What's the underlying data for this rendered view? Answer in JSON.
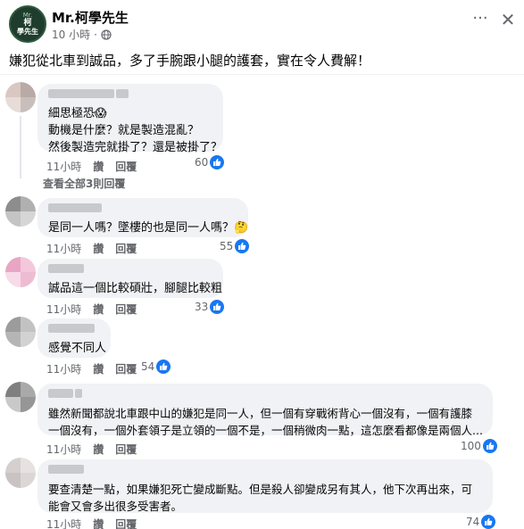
{
  "header": {
    "page_name": "Mr.柯學先生",
    "time": "10 小時",
    "avatar_small": "Mr.",
    "avatar_line1": "柯",
    "avatar_line2": "學先生",
    "more_icon": "more-horizontal-icon",
    "close_icon": "close-icon"
  },
  "post": {
    "text": "嫌犯從北車到誠品，多了手腕跟小腿的護套，實在令人費解！"
  },
  "labels": {
    "like": "讚",
    "reply": "回覆"
  },
  "comments": [
    {
      "lines": [
        "細思極恐😱",
        "動機是什麼？就是製造混亂？",
        "然後製造完就掛了？還是被掛了？"
      ],
      "time": "11小時",
      "reactions": "60",
      "view_replies": "查看全部3則回覆"
    },
    {
      "lines": [
        "是同一人嗎？墜樓的也是同一人嗎？🤔"
      ],
      "time": "11小時",
      "reactions": "55"
    },
    {
      "lines": [
        "誠品這一個比較碩壯，腳腿比較粗"
      ],
      "time": "11小時",
      "reactions": "33"
    },
    {
      "lines": [
        "感覺不同人"
      ],
      "time": "11小時",
      "reactions": "54"
    },
    {
      "lines": [
        "雖然新聞都說北車跟中山的嫌犯是同一人，但一個有穿戰術背心一個沒有，一個有護膝",
        "一個沒有，一個外套領子是立領的一個不是，一個稍微肉一點，這怎麼看都像是兩個人..."
      ],
      "time": "11小時",
      "reactions": "100"
    },
    {
      "lines": [
        "要查清楚一點，如果嫌犯死亡變成斷點。但是殺人卻變成另有其人，他下次再出來，可",
        "能會又會多出很多受害者。"
      ],
      "time": "11小時",
      "reactions": "74"
    }
  ]
}
